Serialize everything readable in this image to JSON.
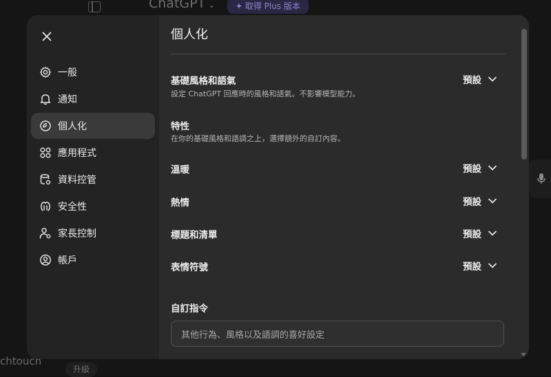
{
  "background": {
    "app_title": "ChatGPT",
    "upgrade_pill": "✦ 取得 Plus 版本",
    "user_name_fragment": "chtouch",
    "upgrade_button": "升級"
  },
  "sidebar": {
    "items": [
      {
        "label": "一般",
        "icon": "gear-icon"
      },
      {
        "label": "通知",
        "icon": "bell-icon"
      },
      {
        "label": "個人化",
        "icon": "personalization-icon",
        "active": true
      },
      {
        "label": "應用程式",
        "icon": "apps-grid-icon"
      },
      {
        "label": "資料控管",
        "icon": "database-icon"
      },
      {
        "label": "安全性",
        "icon": "shield-icon"
      },
      {
        "label": "家長控制",
        "icon": "parental-control-icon"
      },
      {
        "label": "帳戶",
        "icon": "account-icon"
      }
    ]
  },
  "main": {
    "title": "個人化",
    "base_style": {
      "title": "基礎風格和語氣",
      "desc": "設定 ChatGPT 回應時的風格和語氣。不影響模型能力。",
      "value": "預設"
    },
    "traits": {
      "title": "特性",
      "desc": "在你的基礎風格和語調之上，選擇額外的自訂內容。"
    },
    "settings": [
      {
        "label": "溫暖",
        "value": "預設"
      },
      {
        "label": "熱情",
        "value": "預設"
      },
      {
        "label": "標題和清單",
        "value": "預設"
      },
      {
        "label": "表情符號",
        "value": "預設"
      }
    ],
    "custom_instructions": {
      "title": "自訂指令",
      "placeholder": "其他行為、風格以及語調的喜好設定"
    }
  },
  "colors": {
    "modal_bg": "#2b2b2b",
    "sidebar_bg": "#232323",
    "active_item_bg": "#3a3a3a"
  }
}
